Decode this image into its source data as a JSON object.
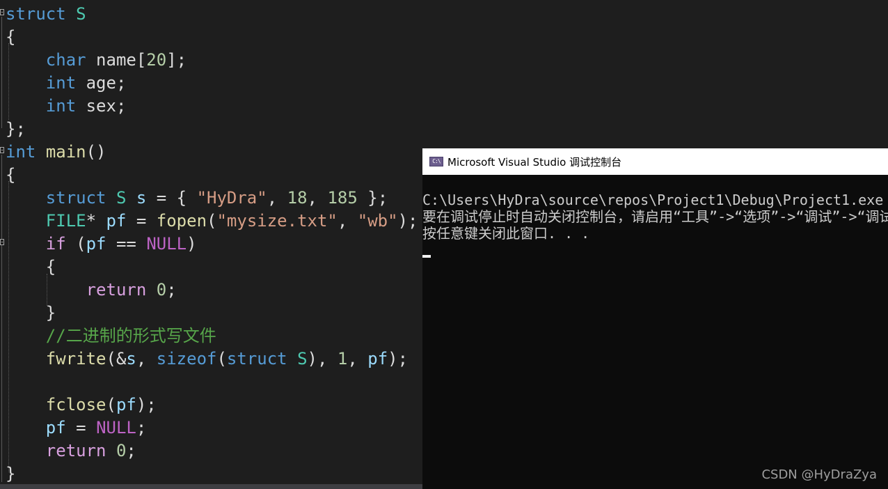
{
  "editor": {
    "l1": {
      "kw": "struct",
      "name": "S"
    },
    "l2": {
      "brace": "{"
    },
    "l3": {
      "type": "char",
      "field": "name",
      "lb": "[",
      "size": "20",
      "rb": "];"
    },
    "l4": {
      "type": "int",
      "field": "age",
      "semi": ";"
    },
    "l5": {
      "type": "int",
      "field": "sex",
      "semi": ";"
    },
    "l6": {
      "close": "};"
    },
    "l7": {
      "type": "int",
      "fn": "main",
      "parens": "()"
    },
    "l8": {
      "brace": "{"
    },
    "l9": {
      "kw": "struct",
      "type": "S",
      "var": "s",
      "eq": " = { ",
      "str": "\"HyDra\"",
      "c1": ", ",
      "n1": "18",
      "c2": ", ",
      "n2": "185",
      "end": " };"
    },
    "l10": {
      "type": "FILE",
      "star": "* ",
      "var": "pf",
      "eq": " = ",
      "fn": "fopen",
      "lp": "(",
      "s1": "\"mysize.txt\"",
      "comma": ", ",
      "s2": "\"wb\"",
      "end": ");"
    },
    "l11": {
      "kw": "if",
      "lp": " (",
      "var": "pf",
      "op": " == ",
      "mac": "NULL",
      "rp": ")"
    },
    "l12": {
      "brace": "{"
    },
    "l13": {
      "kw": "return",
      "num": "0",
      "semi": ";"
    },
    "l14": {
      "brace": "}"
    },
    "l15": {
      "comment": "//二进制的形式写文件"
    },
    "l16": {
      "fn": "fwrite",
      "a": "(&",
      "v1": "s",
      "b": ", ",
      "kw1": "sizeof",
      "c": "(",
      "kw2": "struct",
      "ty": "S",
      "d": "), ",
      "n": "1",
      "e": ", ",
      "v2": "pf",
      "f": ");"
    },
    "l18": {
      "fn": "fclose",
      "a": "(",
      "var": "pf",
      "b": ");"
    },
    "l19": {
      "var": "pf",
      "eq": " = ",
      "mac": "NULL",
      "semi": ";"
    },
    "l20": {
      "kw": "return",
      "num": "0",
      "semi": ";"
    },
    "l21": {
      "brace": "}"
    }
  },
  "console": {
    "icon_text": "C:\\",
    "title": "Microsoft Visual Studio 调试控制台",
    "lines": [
      "C:\\Users\\HyDra\\source\\repos\\Project1\\Debug\\Project1.exe",
      "要在调试停止时自动关闭控制台，请启用“工具”->“选项”->“调试”->“调试停止时自动关闭控制台”。",
      "按任意键关闭此窗口. . ."
    ]
  },
  "watermark": "CSDN @HyDraZya"
}
